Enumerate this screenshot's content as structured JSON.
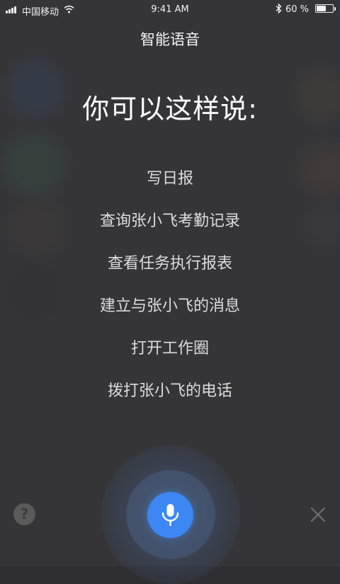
{
  "status_bar": {
    "carrier": "中国移动",
    "time": "9:41 AM",
    "battery_percent": "60 %",
    "battery_level": 0.6
  },
  "header": {
    "title": "智能语音"
  },
  "main": {
    "heading": "你可以这样说:",
    "suggestions": [
      "写日报",
      "查询张小飞考勤记录",
      "查看任务执行报表",
      "建立与张小飞的消息",
      "打开工作圈",
      "拨打张小飞的电话"
    ]
  },
  "footer": {
    "help_label": "?",
    "help_icon": "question-mark-icon",
    "mic_icon": "microphone-icon",
    "close_icon": "close-x-icon"
  },
  "colors": {
    "mic_button": "#3d87f5",
    "overlay": "#37373a",
    "text_primary": "#ffffff",
    "text_secondary": "#dcdcdc"
  }
}
